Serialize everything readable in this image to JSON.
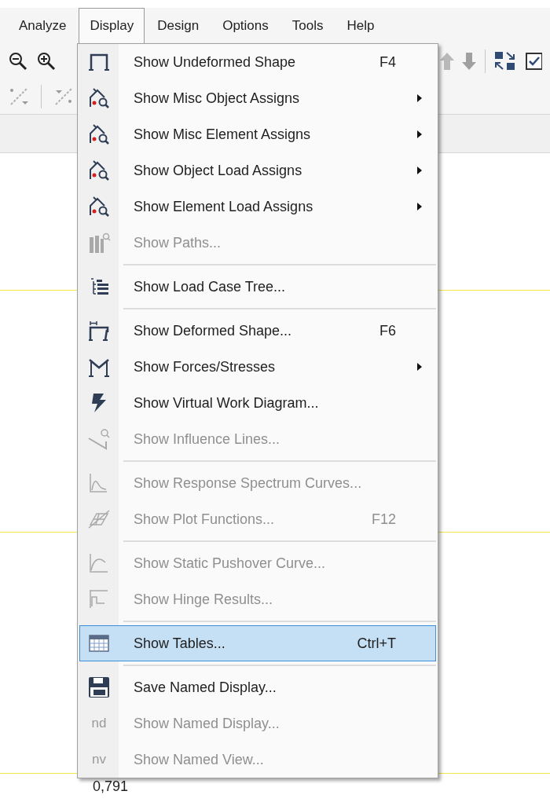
{
  "menu_bar": [
    {
      "label": "Analyze",
      "selected": false
    },
    {
      "label": "Display",
      "selected": true
    },
    {
      "label": "Design",
      "selected": false
    },
    {
      "label": "Options",
      "selected": false
    },
    {
      "label": "Tools",
      "selected": false
    },
    {
      "label": "Help",
      "selected": false
    }
  ],
  "display_menu": {
    "groups": [
      [
        {
          "label": "Show Undeformed Shape",
          "shortcut": "F4",
          "submenu": false,
          "disabled": false,
          "selected": false
        },
        {
          "label": "Show Misc Object Assigns",
          "submenu": true,
          "disabled": false,
          "selected": false
        },
        {
          "label": "Show Misc Element Assigns",
          "submenu": true,
          "disabled": false,
          "selected": false
        },
        {
          "label": "Show Object Load Assigns",
          "submenu": true,
          "disabled": false,
          "selected": false
        },
        {
          "label": "Show Element Load Assigns",
          "submenu": true,
          "disabled": false,
          "selected": false
        },
        {
          "label": "Show Paths...",
          "submenu": false,
          "disabled": true,
          "selected": false
        }
      ],
      [
        {
          "label": "Show Load Case Tree...",
          "submenu": false,
          "disabled": false,
          "selected": false
        }
      ],
      [
        {
          "label": "Show Deformed Shape...",
          "shortcut": "F6",
          "submenu": false,
          "disabled": false,
          "selected": false
        },
        {
          "label": "Show Forces/Stresses",
          "submenu": true,
          "disabled": false,
          "selected": false
        },
        {
          "label": "Show Virtual Work Diagram...",
          "submenu": false,
          "disabled": false,
          "selected": false
        },
        {
          "label": "Show Influence Lines...",
          "submenu": false,
          "disabled": true,
          "selected": false
        }
      ],
      [
        {
          "label": "Show Response Spectrum Curves...",
          "submenu": false,
          "disabled": true,
          "selected": false
        },
        {
          "label": "Show Plot Functions...",
          "shortcut": "F12",
          "submenu": false,
          "disabled": true,
          "selected": false
        }
      ],
      [
        {
          "label": "Show Static Pushover Curve...",
          "submenu": false,
          "disabled": true,
          "selected": false
        },
        {
          "label": "Show Hinge Results...",
          "submenu": false,
          "disabled": true,
          "selected": false
        }
      ],
      [
        {
          "label": "Show Tables...",
          "shortcut": "Ctrl+T",
          "submenu": false,
          "disabled": false,
          "selected": true
        }
      ],
      [
        {
          "label": "Save Named Display...",
          "submenu": false,
          "disabled": false,
          "selected": false
        },
        {
          "label": "Show Named Display...",
          "icon_text": "nd",
          "submenu": false,
          "disabled": true,
          "selected": false
        },
        {
          "label": "Show Named View...",
          "icon_text": "nv",
          "submenu": false,
          "disabled": true,
          "selected": false
        }
      ]
    ]
  },
  "canvas": {
    "value_label": "0,791"
  }
}
